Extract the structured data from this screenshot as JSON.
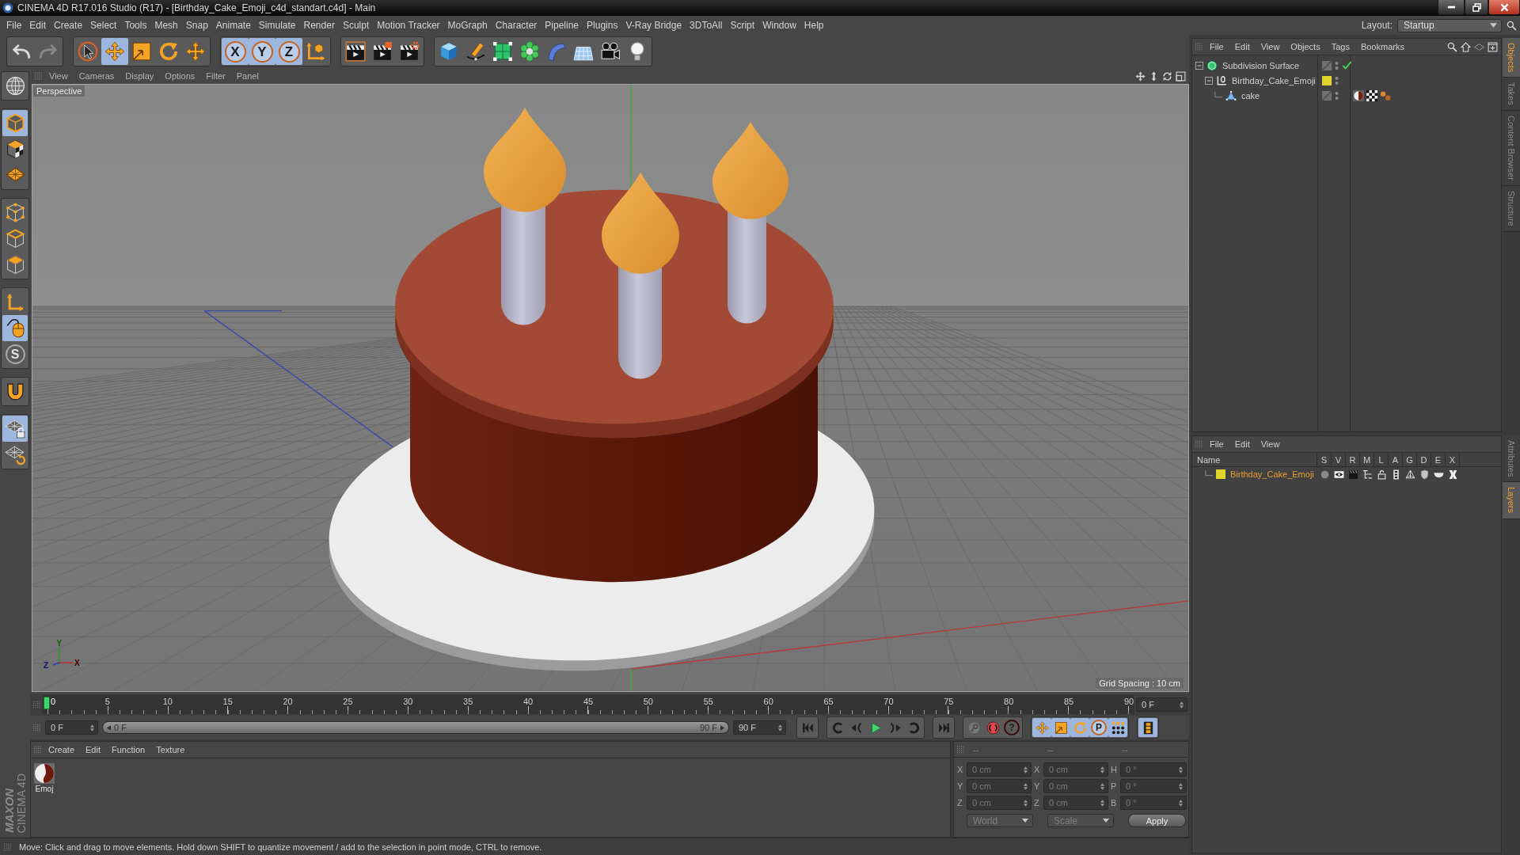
{
  "window": {
    "title": "CINEMA 4D R17.016 Studio (R17) - [Birthday_Cake_Emoji_c4d_standart.c4d] - Main"
  },
  "menu_bar": {
    "items": [
      "File",
      "Edit",
      "Create",
      "Select",
      "Tools",
      "Mesh",
      "Snap",
      "Animate",
      "Simulate",
      "Render",
      "Sculpt",
      "Motion Tracker",
      "MoGraph",
      "Character",
      "Pipeline",
      "Plugins",
      "V-Ray Bridge",
      "3DToAll",
      "Script",
      "Window",
      "Help"
    ],
    "layout_label": "Layout:",
    "layout_value": "Startup"
  },
  "toolbar": {
    "groups": [
      [
        {
          "kind": "undo",
          "selected": false,
          "disabled": false
        },
        {
          "kind": "redo",
          "selected": false,
          "disabled": true
        }
      ],
      [
        {
          "kind": "select",
          "selected": false
        },
        {
          "kind": "move",
          "selected": true
        },
        {
          "kind": "scale",
          "selected": false
        },
        {
          "kind": "rotate",
          "selected": false
        },
        {
          "kind": "transform",
          "selected": false
        }
      ],
      [
        {
          "kind": "axis",
          "label": "X",
          "selected": true
        },
        {
          "kind": "axis",
          "label": "Y",
          "selected": true
        },
        {
          "kind": "axis",
          "label": "Z",
          "selected": true
        },
        {
          "kind": "coords",
          "selected": false
        }
      ],
      [
        {
          "kind": "render_view",
          "selected": false
        },
        {
          "kind": "render_picture",
          "selected": false
        },
        {
          "kind": "render_settings",
          "selected": false
        }
      ],
      [
        {
          "kind": "cube",
          "selected": false
        },
        {
          "kind": "pen",
          "selected": false
        },
        {
          "kind": "subdivision",
          "selected": false
        },
        {
          "kind": "cloner",
          "selected": false
        },
        {
          "kind": "deformer",
          "selected": false
        },
        {
          "kind": "floor",
          "selected": false
        },
        {
          "kind": "camera",
          "selected": false
        },
        {
          "kind": "light",
          "selected": false
        }
      ]
    ]
  },
  "left_tools": {
    "groups": [
      [
        {
          "kind": "editable",
          "selected": false
        }
      ],
      [
        {
          "kind": "model",
          "selected": true
        },
        {
          "kind": "texture",
          "selected": false
        },
        {
          "kind": "workplane",
          "selected": false
        }
      ],
      [
        {
          "kind": "points",
          "selected": false
        },
        {
          "kind": "edges",
          "selected": false
        },
        {
          "kind": "polygons",
          "selected": false
        }
      ],
      [
        {
          "kind": "axis_mode",
          "selected": false
        },
        {
          "kind": "tweak",
          "selected": true
        },
        {
          "kind": "solo",
          "label": "S",
          "selected": false
        }
      ],
      [
        {
          "kind": "snap",
          "selected": false
        }
      ],
      [
        {
          "kind": "grid_lock",
          "selected": true
        },
        {
          "kind": "grid_rotate",
          "selected": false
        }
      ]
    ],
    "logo": [
      "MAXON",
      "CINEMA 4D"
    ]
  },
  "viewport": {
    "menu": [
      "View",
      "Cameras",
      "Display",
      "Options",
      "Filter",
      "Panel"
    ],
    "camera": "Perspective",
    "grid_spacing": "Grid Spacing : 10 cm",
    "axis_labels": [
      "Y",
      "Z",
      "X"
    ]
  },
  "timeline": {
    "marks": [
      {
        "label": "0",
        "selected": true
      },
      {
        "label": "5",
        "selected": false
      },
      {
        "label": "10",
        "selected": false
      },
      {
        "label": "15",
        "selected": false
      },
      {
        "label": "20",
        "selected": false
      },
      {
        "label": "25",
        "selected": false
      },
      {
        "label": "30",
        "selected": false
      },
      {
        "label": "35",
        "selected": false
      },
      {
        "label": "40",
        "selected": false
      },
      {
        "label": "45",
        "selected": false
      },
      {
        "label": "50",
        "selected": false
      },
      {
        "label": "55",
        "selected": false
      },
      {
        "label": "60",
        "selected": false
      },
      {
        "label": "65",
        "selected": false
      },
      {
        "label": "70",
        "selected": false
      },
      {
        "label": "75",
        "selected": false
      },
      {
        "label": "80",
        "selected": false
      },
      {
        "label": "85",
        "selected": false
      },
      {
        "label": "90",
        "selected": false
      }
    ],
    "current_frame": "0 F"
  },
  "playback": {
    "start": "0 F",
    "range": {
      "start_label": "0 F",
      "end_label": "90 F",
      "level": 1
    },
    "end": "90 F",
    "groups": [
      [
        {
          "kind": "to_start",
          "selected": false
        }
      ],
      [
        {
          "kind": "prev_key",
          "selected": false
        },
        {
          "kind": "prev_frame",
          "selected": false
        },
        {
          "kind": "play",
          "selected": false
        },
        {
          "kind": "next_frame",
          "selected": false
        },
        {
          "kind": "next_key",
          "selected": false
        }
      ],
      [
        {
          "kind": "to_end",
          "selected": false
        }
      ],
      [
        {
          "kind": "autokey",
          "selected": false
        },
        {
          "kind": "record",
          "selected": false
        },
        {
          "kind": "help",
          "label": "?",
          "selected": false
        }
      ],
      [
        {
          "kind": "key_move",
          "selected": true
        },
        {
          "kind": "key_scale",
          "selected": true
        },
        {
          "kind": "key_rotate",
          "selected": true
        },
        {
          "kind": "key_param",
          "label": "P",
          "selected": true
        },
        {
          "kind": "key_points",
          "selected": true
        }
      ],
      [
        {
          "kind": "timeline",
          "selected": true
        }
      ]
    ]
  },
  "materials": {
    "menu": [
      "Create",
      "Edit",
      "Function",
      "Texture"
    ],
    "items": [
      {
        "name": "Emoj",
        "selected": false
      }
    ]
  },
  "coordinates": {
    "headers": [
      "--",
      "--",
      "--"
    ],
    "disabled": true,
    "rows": [
      {
        "position_axis": "X",
        "position": "0 cm",
        "size_axis": "X",
        "size": "0 cm",
        "rotation_axis": "H",
        "rotation": "0 °"
      },
      {
        "position_axis": "Y",
        "position": "0 cm",
        "size_axis": "Y",
        "size": "0 cm",
        "rotation_axis": "P",
        "rotation": "0 °"
      },
      {
        "position_axis": "Z",
        "position": "0 cm",
        "size_axis": "Z",
        "size": "0 cm",
        "rotation_axis": "B",
        "rotation": "0 °"
      }
    ],
    "mode": "World",
    "transform": "Scale",
    "apply": "Apply"
  },
  "status_bar": {
    "text": "Move: Click and drag to move elements. Hold down SHIFT to quantize movement / add to the selection in point mode, CTRL to remove."
  },
  "object_manager": {
    "menu": [
      "File",
      "Edit",
      "View",
      "Objects",
      "Tags",
      "Bookmarks"
    ],
    "tree": [
      {
        "name": "Subdivision Surface",
        "kind": "subdivision",
        "expanded": true,
        "selected": false,
        "enabled": true,
        "children": [
          {
            "name": "Birthday_Cake_Emoji",
            "kind": "null",
            "expanded": true,
            "selected": false,
            "color": "#e2d42c",
            "children": [
              {
                "name": "cake",
                "kind": "polygon",
                "selected": false,
                "tags": [
                  {
                    "kind": "material"
                  },
                  {
                    "kind": "checker"
                  },
                  {
                    "kind": "dots"
                  }
                ]
              }
            ]
          }
        ]
      }
    ]
  },
  "layer_manager": {
    "menu": [
      "File",
      "Edit",
      "View"
    ],
    "columns": [
      "Name",
      "S",
      "V",
      "R",
      "M",
      "L",
      "A",
      "G",
      "D",
      "E",
      "X"
    ],
    "layers": [
      {
        "name": "Birthday_Cake_Emoji",
        "color": "#e2d42c",
        "selected": false,
        "flags": [
          {
            "kind": "solo",
            "on": false
          },
          {
            "kind": "view",
            "on": true
          },
          {
            "kind": "render",
            "on": true
          },
          {
            "kind": "manager",
            "on": true
          },
          {
            "kind": "lock",
            "on": false
          },
          {
            "kind": "animation",
            "on": true
          },
          {
            "kind": "generators",
            "on": true
          },
          {
            "kind": "deformers",
            "on": true
          },
          {
            "kind": "expressions",
            "on": true
          },
          {
            "kind": "xrefs",
            "on": true
          }
        ]
      }
    ]
  },
  "side_tabs": {
    "upper": [
      {
        "label": "Objects",
        "selected": true
      },
      {
        "label": "Takes",
        "selected": false
      },
      {
        "label": "Content Browser",
        "selected": false
      },
      {
        "label": "Structure",
        "selected": false
      }
    ],
    "lower": [
      {
        "label": "Attributes",
        "selected": false
      },
      {
        "label": "Layers",
        "selected": true
      }
    ]
  }
}
